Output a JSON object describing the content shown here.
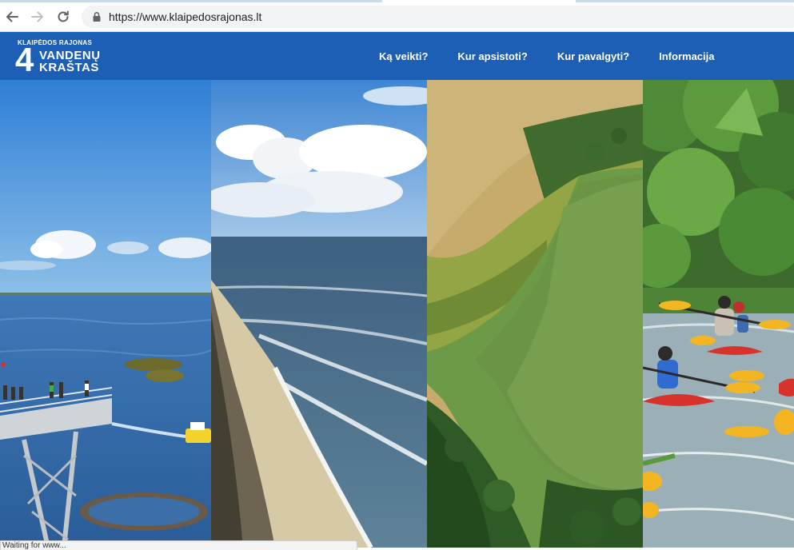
{
  "browser": {
    "url": "https://www.klaipedosrajonas.lt",
    "status_text": "Waiting for www..."
  },
  "site": {
    "logo": {
      "top_line": "KLAIPĖDOS RAJONAS",
      "numeral": "4",
      "word_1": "VANDENŲ",
      "word_2": "KRAŠTAS"
    },
    "nav": [
      {
        "label": "Ką veikti?"
      },
      {
        "label": "Kur apsistoti?"
      },
      {
        "label": "Kur pavalgyti?"
      },
      {
        "label": "Informacija"
      }
    ],
    "brand_color": "#1c5fb5"
  },
  "hero_panels": [
    {
      "scene": "lagoon-observation-tower"
    },
    {
      "scene": "baltic-sea-coast"
    },
    {
      "scene": "river-delta-aerial"
    },
    {
      "scene": "kayaking-river"
    }
  ]
}
